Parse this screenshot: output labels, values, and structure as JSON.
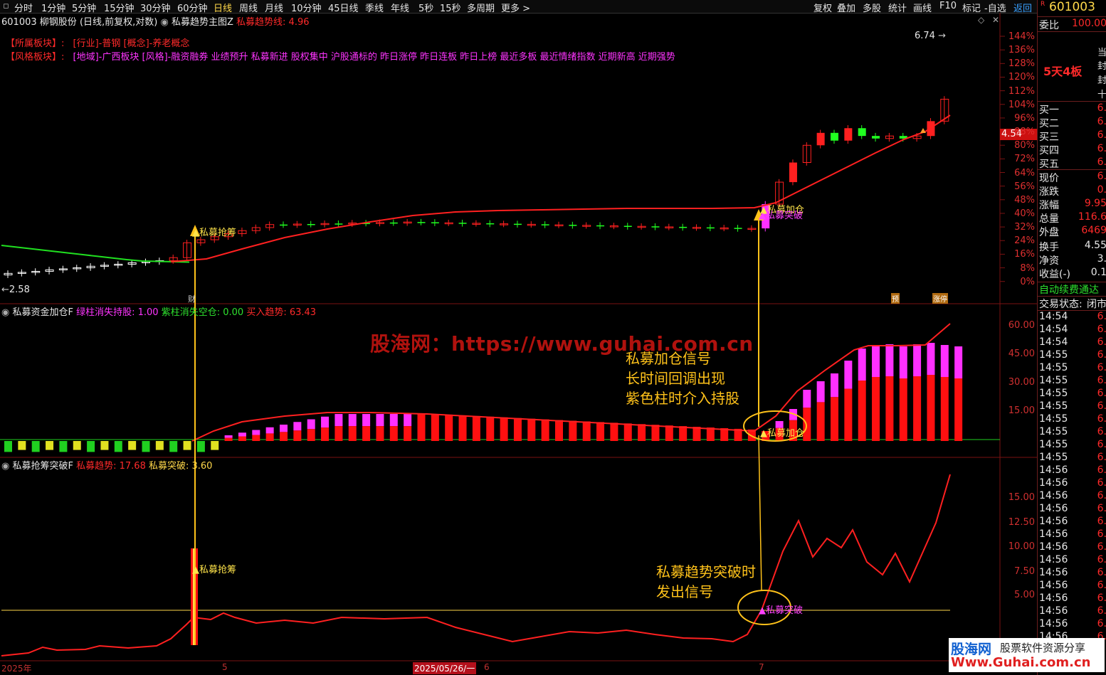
{
  "toolbar": {
    "left_items": [
      "分时",
      "1分钟",
      "5分钟",
      "15分钟",
      "30分钟",
      "60分钟",
      "日线",
      "周线",
      "月线",
      "10分钟",
      "45日线",
      "季线",
      "年线",
      "5秒",
      "15秒",
      "多周期",
      "更多 >"
    ],
    "active_index": 6,
    "right_items": [
      "复权",
      "叠加",
      "多股",
      "统计",
      "画线",
      "F10",
      "标记",
      "-自选",
      "返回"
    ]
  },
  "header": {
    "code": "601003",
    "name": "柳钢股份",
    "mode": "(日线,前复权,对数)",
    "indicator": "私募趋势主图Z",
    "indicator_line": "私募趋势线: 4.96"
  },
  "sector": {
    "label1": "【所属板块】:",
    "value1": "[行业]-普钢 [概念]-养老概念",
    "label2": "【风格板块】:",
    "value2": "[地域]-广西板块 [风格]-融资融券 业绩预升 私募新进 股权集中 沪股通标的 昨日涨停 昨日连板 昨日上榜 最近多板 最近情绪指数 近期新高 近期强势"
  },
  "main_chart": {
    "high_label": "6.74",
    "low_label": "2.58",
    "price_tag": "4.54",
    "price_tag_color": "#cc1010",
    "axis": [
      "144%",
      "136%",
      "128%",
      "120%",
      "112%",
      "104%",
      "96%",
      "88%",
      "80%",
      "72%",
      "64%",
      "56%",
      "48%",
      "40%",
      "32%",
      "24%",
      "16%",
      "8%",
      "0%"
    ],
    "tag_grab": "私募抢筹",
    "tag_add": "私募加仓",
    "tag_break": "私募突破",
    "mini_tags": [
      "预",
      "涨停"
    ],
    "small_mark": "财"
  },
  "sub1": {
    "title": "私募资金加仓F",
    "green_exit": "绿柱消失持股: 1.00",
    "purple_exit": "紫柱消失空仓: 0.00",
    "buy_trend": "买入趋势: 63.43",
    "axis": [
      "60.00",
      "45.00",
      "30.00",
      "15.00"
    ],
    "tag_add": "私募加仓",
    "annotation": [
      "私募加仓信号",
      "长时间回调出现",
      "紫色柱时介入持股"
    ]
  },
  "sub2": {
    "title": "私募抢筹突破F",
    "trend": "私募趋势: 17.68",
    "breakout": "私募突破: 3.60",
    "axis": [
      "15.00",
      "12.50",
      "10.00",
      "7.50",
      "5.00"
    ],
    "tag_grab": "私募抢筹",
    "tag_break": "私募突破",
    "annotation": [
      "私募趋势突破时",
      "发出信号"
    ]
  },
  "watermark": "股海网：https://www.guhai.com.cn",
  "dates": {
    "d1": "2025年",
    "d2": "5",
    "d3": "2025/05/26/一",
    "d4": "6",
    "d5": "7"
  },
  "right_panel": {
    "code": "601003",
    "webi_label": "委比",
    "webi_value": "100.00",
    "board": "5天4板",
    "side_chars": [
      "当",
      "封",
      "封",
      "十"
    ],
    "bids": [
      "买一",
      "买二",
      "买三",
      "买四",
      "买五"
    ],
    "bid_vals": [
      "6.",
      "6.",
      "6.",
      "6.",
      "6."
    ],
    "stats_labels": [
      "现价",
      "涨跌",
      "涨幅",
      "总量",
      "外盘",
      "换手",
      "净资",
      "收益(-)"
    ],
    "stats_values": [
      "6.",
      "0.",
      "9.95",
      "116.6",
      "6469",
      "4.55",
      "3.",
      "0.1"
    ],
    "auto_renew": "自动续费通达",
    "trade_status_label": "交易状态:",
    "trade_status_value": "闭市",
    "ticks_times": [
      "14:54",
      "14:54",
      "14:54",
      "14:55",
      "14:55",
      "14:55",
      "14:55",
      "14:55",
      "14:55",
      "14:55",
      "14:55",
      "14:55",
      "14:56",
      "14:56",
      "14:56",
      "14:56",
      "14:56",
      "14:56",
      "14:56",
      "14:56",
      "14:56",
      "14:56",
      "14:56",
      "14:56",
      "14:56",
      "14:56"
    ],
    "ticks_price": "6."
  },
  "logo": {
    "brand": "股海网",
    "slogan": "股票软件资源分享",
    "url": "Www.Guhai.com.cn"
  }
}
